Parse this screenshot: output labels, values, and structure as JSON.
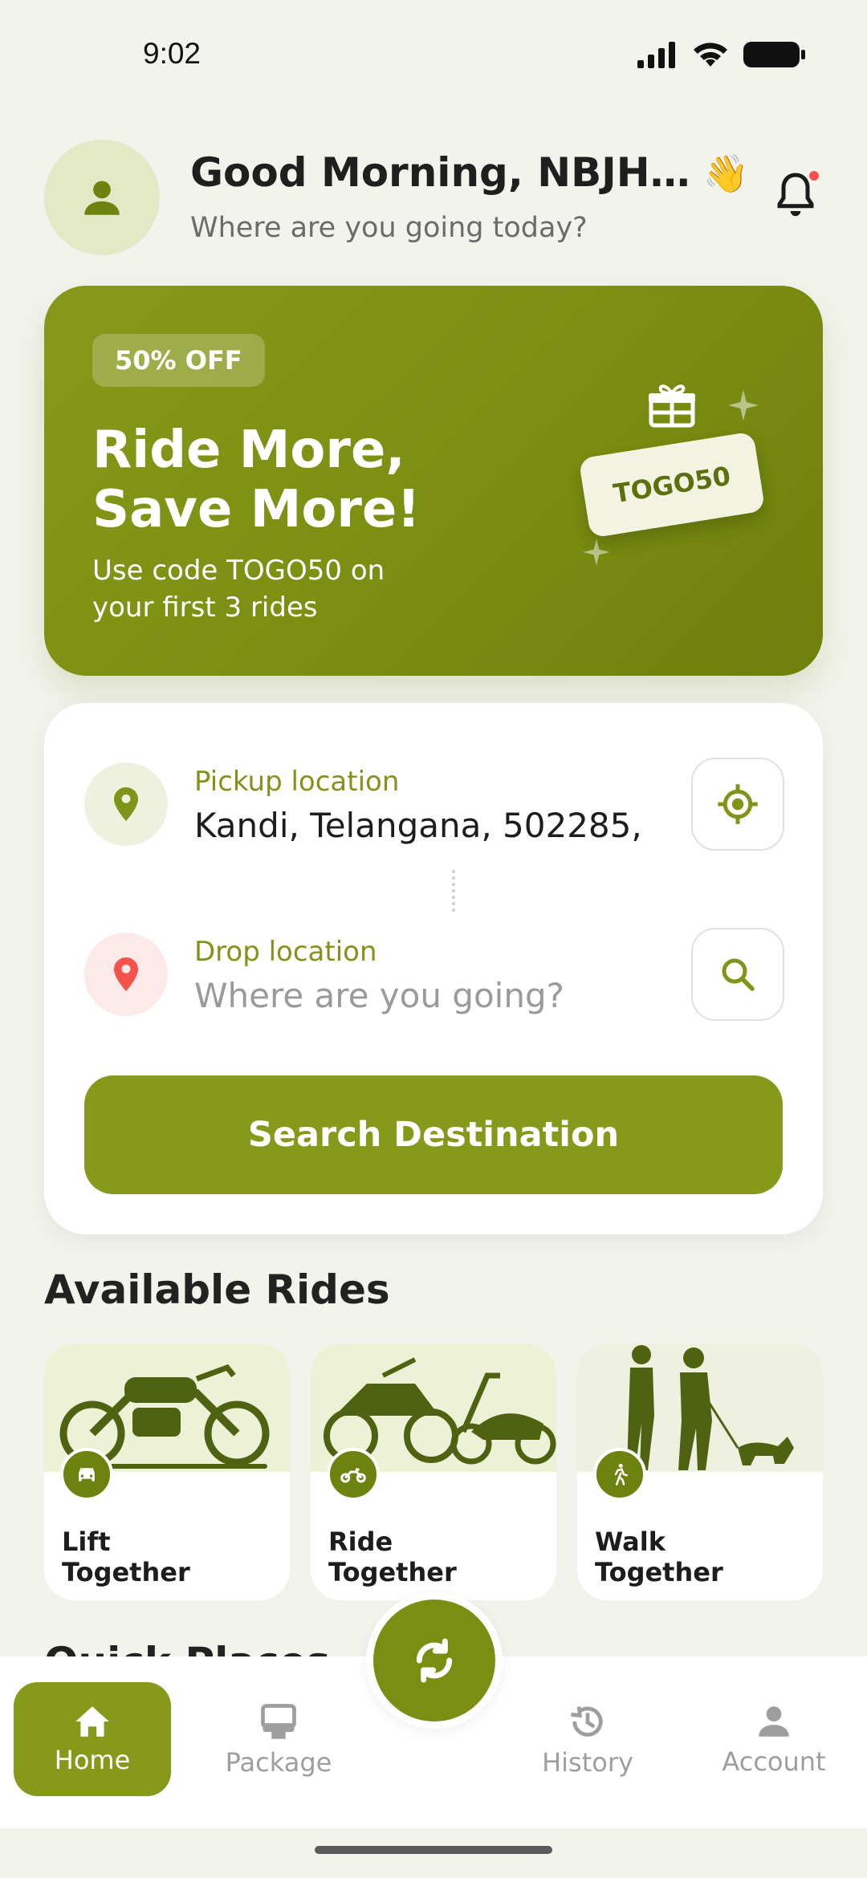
{
  "status": {
    "time": "9:02"
  },
  "header": {
    "greeting": "Good Morning, NBJH…",
    "wave": "👋",
    "subtitle": "Where are you going today?"
  },
  "promo": {
    "badge": "50% OFF",
    "title": "Ride More, Save More!",
    "description": "Use code TOGO50 on your first 3 rides",
    "coupon_code": "TOGO50"
  },
  "location": {
    "pickup_label": "Pickup location",
    "pickup_value": "Kandi, Telangana, 502285,",
    "drop_label": "Drop location",
    "drop_placeholder": "Where are you going?",
    "search_button": "Search Destination"
  },
  "rides": {
    "title": "Available Rides",
    "items": [
      {
        "name": "Lift Together",
        "icon": "car-icon"
      },
      {
        "name": "Ride Together",
        "icon": "motorcycle-icon"
      },
      {
        "name": "Walk Together",
        "icon": "walking-icon"
      }
    ]
  },
  "quick_places": {
    "title": "Quick Places"
  },
  "nav": {
    "items": [
      {
        "label": "Home",
        "icon": "home-icon",
        "active": true
      },
      {
        "label": "Package",
        "icon": "package-icon",
        "active": false
      },
      {
        "label": "History",
        "icon": "history-icon",
        "active": false
      },
      {
        "label": "Account",
        "icon": "account-icon",
        "active": false
      }
    ],
    "fab_icon": "swap-icon"
  },
  "colors": {
    "primary": "#86991a",
    "primary_dark": "#6e8210",
    "accent_red": "#ff4f4f",
    "background": "#f3f3ee"
  }
}
